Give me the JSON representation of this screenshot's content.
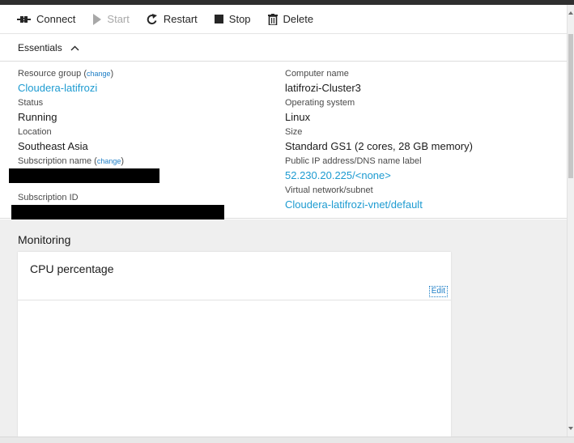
{
  "toolbar": {
    "connect": "Connect",
    "start": "Start",
    "restart": "Restart",
    "stop": "Stop",
    "delete": "Delete"
  },
  "essentials": {
    "header": "Essentials",
    "change_link": "change",
    "left": {
      "resource_group_label": "Resource group",
      "resource_group_value": "Cloudera-latifrozi",
      "status_label": "Status",
      "status_value": "Running",
      "location_label": "Location",
      "location_value": "Southeast Asia",
      "subscription_name_label": "Subscription name",
      "subscription_id_label": "Subscription ID"
    },
    "right": {
      "computer_name_label": "Computer name",
      "computer_name_value": "latifrozi-Cluster3",
      "os_label": "Operating system",
      "os_value": "Linux",
      "size_label": "Size",
      "size_value": "Standard GS1 (2 cores, 28 GB memory)",
      "public_ip_label": "Public IP address/DNS name label",
      "public_ip_value": "52.230.20.225/<none>",
      "vnet_label": "Virtual network/subnet",
      "vnet_value": "Cloudera-latifrozi-vnet/default"
    }
  },
  "monitoring": {
    "title": "Monitoring",
    "tile_title": "CPU percentage",
    "edit_label": "Edit"
  },
  "colors": {
    "link": "#1d9bd1",
    "topbar": "#2f2f2f",
    "panel_bg": "#efefef"
  }
}
